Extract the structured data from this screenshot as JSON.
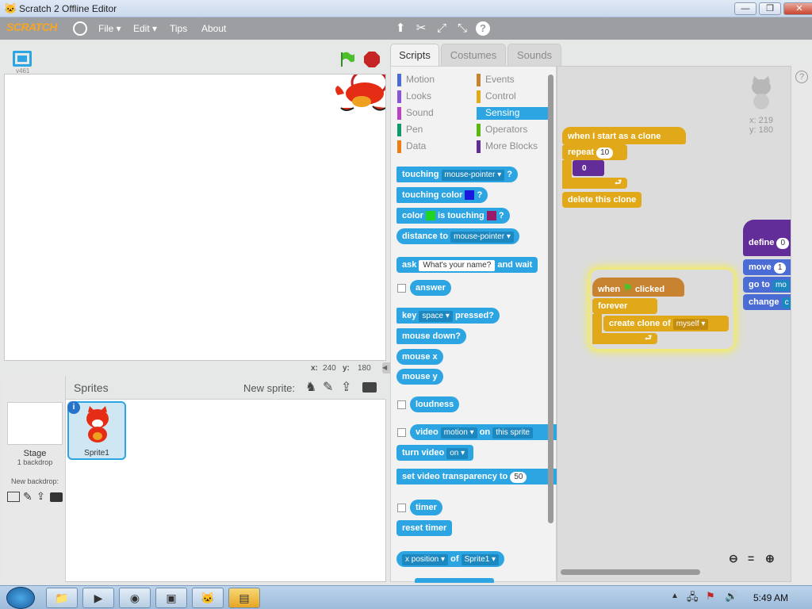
{
  "window": {
    "title": "Scratch 2 Offline Editor",
    "minimize": "—",
    "maximize": "❐",
    "close": "✕"
  },
  "menu": {
    "logo": "SCRATCH",
    "items": [
      "File ▾",
      "Edit ▾",
      "Tips",
      "About"
    ],
    "globe": "🌐"
  },
  "toolbar_icons": [
    "stamp-icon",
    "cut-icon",
    "grow-icon",
    "shrink-icon",
    "help-icon"
  ],
  "stage": {
    "version": "v461",
    "x_label": "x:",
    "x_value": "240",
    "y_label": "y:",
    "y_value": "180"
  },
  "sprites": {
    "header": "Sprites",
    "new_sprite_label": "New sprite:",
    "stage_label": "Stage",
    "stage_sub": "1 backdrop",
    "new_backdrop_label": "New backdrop:",
    "sprite1": "Sprite1"
  },
  "tabs": [
    "Scripts",
    "Costumes",
    "Sounds"
  ],
  "categories": [
    {
      "label": "Motion",
      "color": "#4a6cd4"
    },
    {
      "label": "Events",
      "color": "#c88330"
    },
    {
      "label": "Looks",
      "color": "#8a55d7"
    },
    {
      "label": "Control",
      "color": "#e1a91a"
    },
    {
      "label": "Sound",
      "color": "#bb42c3"
    },
    {
      "label": "Sensing",
      "color": "#2ca5e2"
    },
    {
      "label": "Pen",
      "color": "#0e9a6c"
    },
    {
      "label": "Operators",
      "color": "#5cb712"
    },
    {
      "label": "Data",
      "color": "#ee7d16"
    },
    {
      "label": "More Blocks",
      "color": "#632d99"
    }
  ],
  "palette": {
    "touching": "touching",
    "mouse_pointer": "mouse-pointer",
    "q": "?",
    "touching_color": "touching color",
    "color": "color",
    "is_touching": "is touching",
    "distance_to": "distance to",
    "ask": "ask",
    "ask_default": "What's your name?",
    "and_wait": "and wait",
    "answer": "answer",
    "key": "key",
    "space": "space",
    "pressed": "pressed?",
    "mouse_down": "mouse down?",
    "mouse_x": "mouse x",
    "mouse_y": "mouse y",
    "loudness": "loudness",
    "video": "video",
    "motion": "motion",
    "on": "on",
    "this_sprite": "this sprite",
    "turn_video": "turn video",
    "on_opt": "on",
    "set_video_transparency": "set video transparency to",
    "transparency_value": "50",
    "timer": "timer",
    "reset_timer": "reset timer",
    "x_position": "x position",
    "of": "of",
    "sprite1": "Sprite1"
  },
  "scripts": {
    "sprite_x": "x: 219",
    "sprite_y": "y: 180",
    "clone_hat": "when I start as a clone",
    "repeat": "repeat",
    "repeat_value": "10",
    "zero_reporter": "0",
    "delete_clone": "delete this clone",
    "when": "when",
    "clicked": "clicked",
    "forever": "forever",
    "create_clone": "create clone of",
    "myself": "myself",
    "define": "define",
    "define_input": "0",
    "move": "move",
    "move_value": "1",
    "go_to": "go to",
    "go_to_value": "mo",
    "change": "change",
    "change_value": "c"
  },
  "taskbar": {
    "time": "5:49 AM"
  }
}
